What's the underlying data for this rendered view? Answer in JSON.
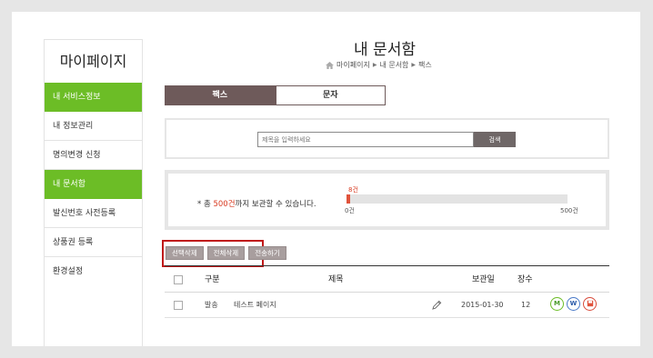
{
  "sidebar": {
    "title": "마이페이지",
    "items": [
      {
        "label": "내 서비스정보",
        "active": true
      },
      {
        "label": "내 정보관리",
        "active": false
      },
      {
        "label": "명의변경 신청",
        "active": false
      },
      {
        "label": "내 문서함",
        "active": true
      },
      {
        "label": "발신번호 사전등록",
        "active": false
      },
      {
        "label": "상품권 등록",
        "active": false
      },
      {
        "label": "환경설정",
        "active": false
      }
    ]
  },
  "header": {
    "title": "내 문서함",
    "breadcrumb": [
      "마이페이지",
      "내 문서함",
      "팩스"
    ]
  },
  "tabs": [
    {
      "label": "팩스",
      "active": true
    },
    {
      "label": "문자",
      "active": false
    }
  ],
  "search": {
    "placeholder": "제목을 입력하세요",
    "button_label": "검색"
  },
  "storage": {
    "notice_prefix": "* 총 ",
    "notice_highlight": "500건",
    "notice_suffix": "까지 보관할 수 있습니다.",
    "used_label": "8건",
    "used_value": 8,
    "max_value": 500,
    "min_label": "0건",
    "max_label": "500건"
  },
  "actions": {
    "select_delete": "선택삭제",
    "delete_all": "전체삭제",
    "resend": "전송하기"
  },
  "table": {
    "headers": {
      "type": "구분",
      "title": "제목",
      "date": "보관일",
      "pages": "장수"
    },
    "rows": [
      {
        "type": "발송",
        "title": "테스트 페이지",
        "date": "2015-01-30",
        "pages": "12"
      }
    ],
    "row_icons": {
      "m": "M",
      "w": "W"
    }
  },
  "colors": {
    "accent_green": "#6cbd26",
    "tab_active": "#6e5a5a",
    "highlight_red": "#d83a21"
  }
}
